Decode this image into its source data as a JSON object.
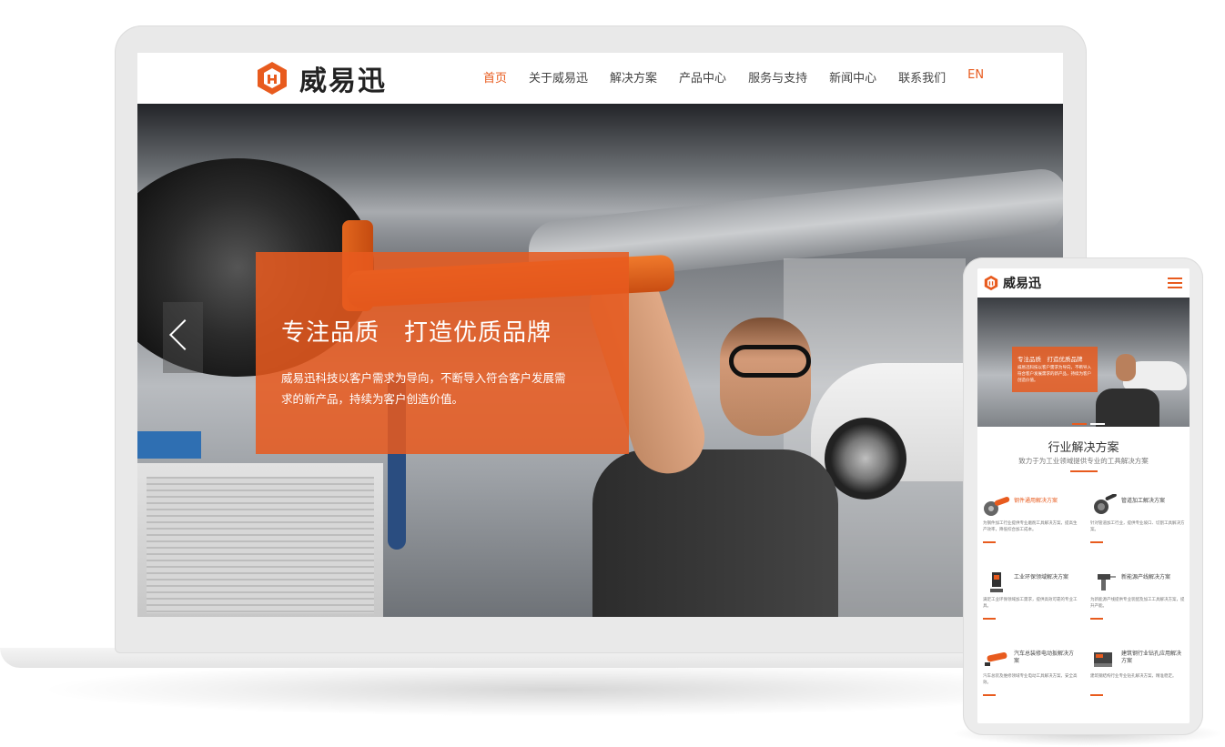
{
  "brand": {
    "name": "威易迅",
    "accent": "#e85b1e"
  },
  "desktop": {
    "nav": {
      "items": [
        "首页",
        "关于威易迅",
        "解决方案",
        "产品中心",
        "服务与支持",
        "新闻中心",
        "联系我们"
      ],
      "lang": "EN",
      "active_index": 0
    },
    "hero": {
      "title": "专注品质　打造优质品牌",
      "description": "威易迅科技以客户需求为导向，不断导入符合客户发展需求的新产品，持续为客户创造价值。"
    }
  },
  "mobile": {
    "hero": {
      "title": "专注品质　打造优质品牌",
      "description": "威易迅科技以客户需求为导向，不断导入符合客户发展需求的新产品，持续为客户创造价值。"
    },
    "section": {
      "title": "行业解决方案",
      "subtitle": "致力于为工业领域提供专业的工具解决方案"
    },
    "solutions": [
      {
        "title": "钢件通用解决方案",
        "desc": "为钢件加工行业提供专业磨削工具解决方案，提高生产效率，降低综合加工成本。",
        "highlight": true
      },
      {
        "title": "管道加工解决方案",
        "desc": "针对管道加工行业，提供专业坡口、切割工具解决方案。",
        "highlight": false
      },
      {
        "title": "工业环保领域解决方案",
        "desc": "满足工业环保领域加工需求，提供高效可靠的专业工具。",
        "highlight": false
      },
      {
        "title": "新能源产线解决方案",
        "desc": "为新能源产线提供专业装配及加工工具解决方案，提升产能。",
        "highlight": false
      },
      {
        "title": "汽车总装修电动扳解决方案",
        "desc": "汽车总装及维修领域专业电动工具解决方案，安全高效。",
        "highlight": false
      },
      {
        "title": "建筑钢行业钻孔应用解决方案",
        "desc": "建筑钢结构行业专业钻孔解决方案，精准稳定。",
        "highlight": false
      }
    ]
  }
}
